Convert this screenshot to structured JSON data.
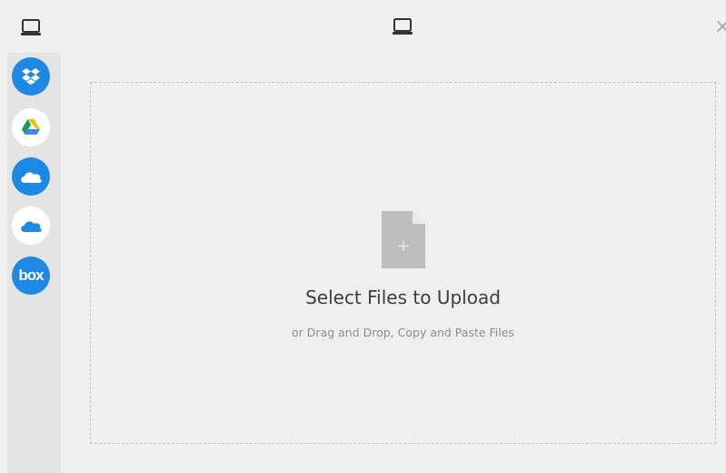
{
  "sidebar": {
    "items": [
      {
        "icon": "computer-icon"
      },
      {
        "icon": "dropbox-icon",
        "bg": "#1e88e5"
      },
      {
        "icon": "google-drive-icon",
        "bg": "#ffffff"
      },
      {
        "icon": "onedrive-icon",
        "bg": "#1e88e5"
      },
      {
        "icon": "onedrive-business-icon",
        "bg": "#ffffff"
      },
      {
        "icon": "box-icon",
        "bg": "#1e88e5",
        "label": "box"
      }
    ]
  },
  "header": {
    "icon": "computer-icon",
    "close_label": "×"
  },
  "dropzone": {
    "title": "Select Files to Upload",
    "subtitle": "or Drag and Drop, Copy and Paste Files"
  },
  "colors": {
    "accent": "#1e88e5",
    "background": "#efefef",
    "rail": "#e4e4e4",
    "file_icon": "#bdbdbd"
  }
}
